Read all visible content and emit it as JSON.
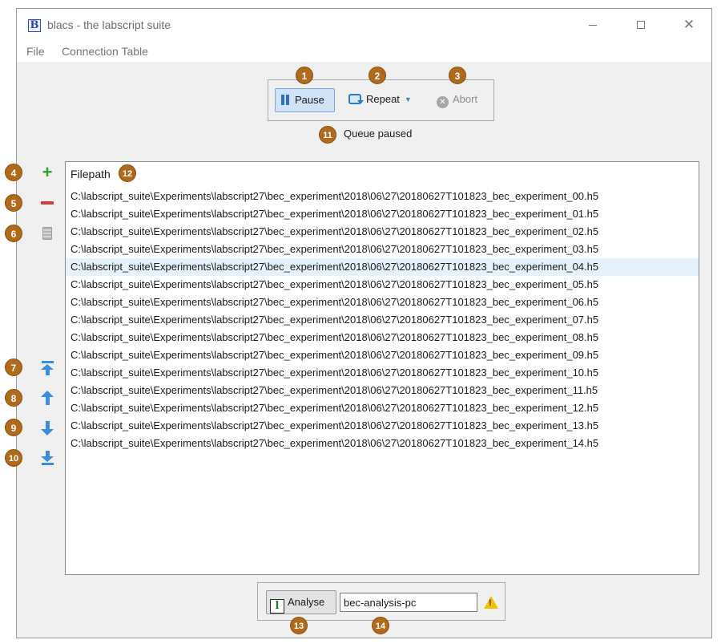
{
  "window": {
    "title": "blacs - the labscript suite",
    "icon_letter": "B"
  },
  "menu": {
    "items": [
      "File",
      "Connection Table"
    ]
  },
  "controls": {
    "pause_label": "Pause",
    "repeat_label": "Repeat",
    "abort_label": "Abort",
    "status": "Queue paused"
  },
  "queue": {
    "header": "Filepath",
    "selected_index": 4,
    "rows": [
      "C:\\labscript_suite\\Experiments\\labscript27\\bec_experiment\\2018\\06\\27\\20180627T101823_bec_experiment_00.h5",
      "C:\\labscript_suite\\Experiments\\labscript27\\bec_experiment\\2018\\06\\27\\20180627T101823_bec_experiment_01.h5",
      "C:\\labscript_suite\\Experiments\\labscript27\\bec_experiment\\2018\\06\\27\\20180627T101823_bec_experiment_02.h5",
      "C:\\labscript_suite\\Experiments\\labscript27\\bec_experiment\\2018\\06\\27\\20180627T101823_bec_experiment_03.h5",
      "C:\\labscript_suite\\Experiments\\labscript27\\bec_experiment\\2018\\06\\27\\20180627T101823_bec_experiment_04.h5",
      "C:\\labscript_suite\\Experiments\\labscript27\\bec_experiment\\2018\\06\\27\\20180627T101823_bec_experiment_05.h5",
      "C:\\labscript_suite\\Experiments\\labscript27\\bec_experiment\\2018\\06\\27\\20180627T101823_bec_experiment_06.h5",
      "C:\\labscript_suite\\Experiments\\labscript27\\bec_experiment\\2018\\06\\27\\20180627T101823_bec_experiment_07.h5",
      "C:\\labscript_suite\\Experiments\\labscript27\\bec_experiment\\2018\\06\\27\\20180627T101823_bec_experiment_08.h5",
      "C:\\labscript_suite\\Experiments\\labscript27\\bec_experiment\\2018\\06\\27\\20180627T101823_bec_experiment_09.h5",
      "C:\\labscript_suite\\Experiments\\labscript27\\bec_experiment\\2018\\06\\27\\20180627T101823_bec_experiment_10.h5",
      "C:\\labscript_suite\\Experiments\\labscript27\\bec_experiment\\2018\\06\\27\\20180627T101823_bec_experiment_11.h5",
      "C:\\labscript_suite\\Experiments\\labscript27\\bec_experiment\\2018\\06\\27\\20180627T101823_bec_experiment_12.h5",
      "C:\\labscript_suite\\Experiments\\labscript27\\bec_experiment\\2018\\06\\27\\20180627T101823_bec_experiment_13.h5",
      "C:\\labscript_suite\\Experiments\\labscript27\\bec_experiment\\2018\\06\\27\\20180627T101823_bec_experiment_14.h5"
    ]
  },
  "analysis": {
    "button_label": "Analyse",
    "host_value": "bec-analysis-pc"
  },
  "badges": [
    "1",
    "2",
    "3",
    "4",
    "5",
    "6",
    "7",
    "8",
    "9",
    "10",
    "11",
    "12",
    "13",
    "14"
  ],
  "icons": {
    "pause": "pause-icon",
    "repeat": "repeat-icon",
    "abort": "abort-icon",
    "add": "plus-icon",
    "remove": "minus-icon",
    "clear": "clipboard-icon",
    "move_top": "move-to-top-icon",
    "move_up": "arrow-up-icon",
    "move_down": "arrow-down-icon",
    "move_bottom": "move-to-bottom-icon",
    "analyse": "analysis-icon",
    "warning": "warning-icon"
  },
  "colors": {
    "badge": "#b06a1c",
    "selection": "#e5f1fb",
    "accent": "#3a8ee0"
  }
}
